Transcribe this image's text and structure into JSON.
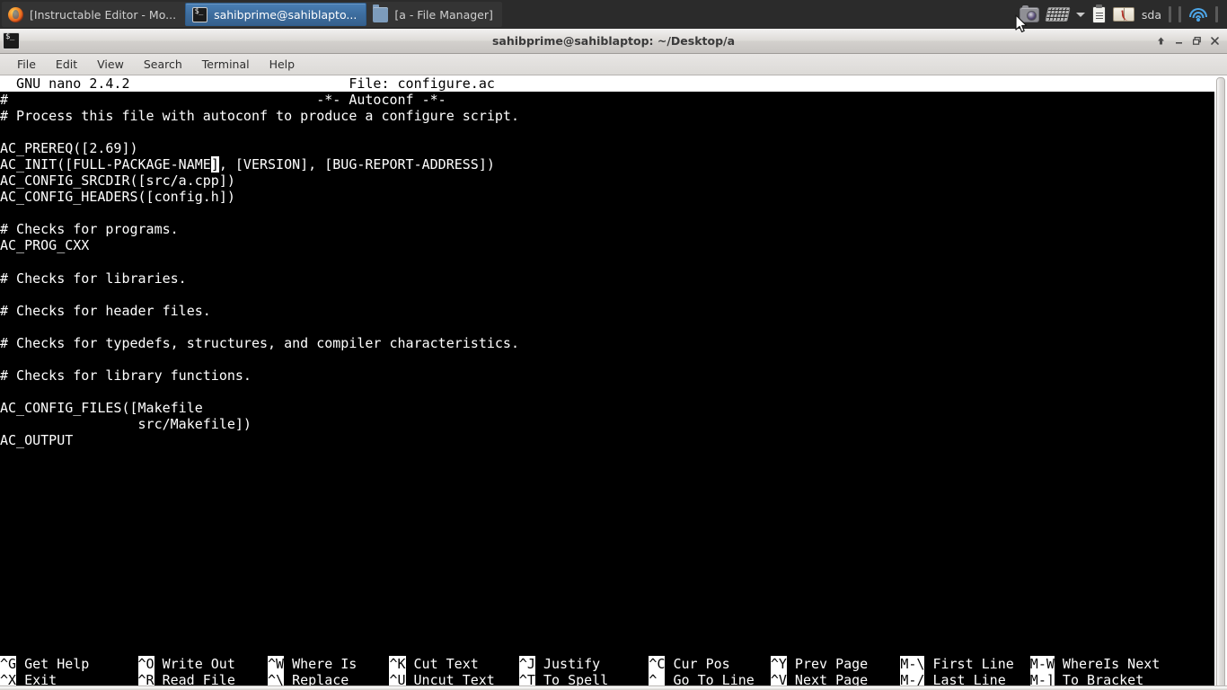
{
  "taskbar": {
    "tasks": [
      {
        "icon": "firefox-icon",
        "label": "[Instructable Editor - Mo...",
        "active": false
      },
      {
        "icon": "terminal-icon",
        "label": "sahibprime@sahiblapto...",
        "active": true
      },
      {
        "icon": "folder-icon",
        "label": "[a - File Manager]",
        "active": false
      }
    ],
    "tray": {
      "camera_icon": "camera-icon",
      "keyboard_icon": "keyboard-layout-icon",
      "caret_icon": "chevron-down-icon",
      "clipboard_icon": "clipboard-icon",
      "dictionary_icon": "dictionary-book-icon",
      "disk_label": "sda",
      "wifi_icon": "wifi-icon"
    }
  },
  "window": {
    "title": "sahibprime@sahiblaptop: ~/Desktop/a",
    "icon": "terminal-icon",
    "controls": {
      "shade": "shade-window-button",
      "minimize": "minimize-window-button",
      "maximize": "maximize-window-button",
      "close": "close-window-button"
    },
    "menus": [
      "File",
      "Edit",
      "View",
      "Search",
      "Terminal",
      "Help"
    ]
  },
  "nano": {
    "version_label": "GNU nano 2.4.2",
    "file_label": "File: configure.ac",
    "title_line": "  GNU nano 2.4.2                           File: configure.ac                                                                ",
    "lines": [
      "#                                      -*- Autoconf -*-",
      "# Process this file with autoconf to produce a configure script.",
      "",
      "AC_PREREQ([2.69])",
      "AC_CONFIG_SRCDIR([src/a.cpp])",
      "AC_CONFIG_HEADERS([config.h])",
      "",
      "# Checks for programs.",
      "AC_PROG_CXX",
      "",
      "# Checks for libraries.",
      "",
      "# Checks for header files.",
      "",
      "# Checks for typedefs, structures, and compiler characteristics.",
      "",
      "# Checks for library functions.",
      "",
      "AC_CONFIG_FILES([Makefile",
      "                 src/Makefile])",
      "AC_OUTPUT"
    ],
    "cursor_line": {
      "before": "AC_INIT([FULL-PACKAGE-NAME",
      "cursor_char": "]",
      "after": ", [VERSION], [BUG-REPORT-ADDRESS])"
    },
    "shortcuts_row1": [
      {
        "key": "^G",
        "label": " Get Help"
      },
      {
        "key": "^O",
        "label": " Write Out"
      },
      {
        "key": "^W",
        "label": " Where Is"
      },
      {
        "key": "^K",
        "label": " Cut Text"
      },
      {
        "key": "^J",
        "label": " Justify"
      },
      {
        "key": "^C",
        "label": " Cur Pos"
      },
      {
        "key": "^Y",
        "label": " Prev Page"
      },
      {
        "key": "M-\\",
        "label": " First Line"
      },
      {
        "key": "M-W",
        "label": " WhereIs Next"
      }
    ],
    "shortcuts_row2": [
      {
        "key": "^X",
        "label": " Exit"
      },
      {
        "key": "^R",
        "label": " Read File"
      },
      {
        "key": "^\\",
        "label": " Replace"
      },
      {
        "key": "^U",
        "label": " Uncut Text"
      },
      {
        "key": "^T",
        "label": " To Spell"
      },
      {
        "key": "^_",
        "label": " Go To Line"
      },
      {
        "key": "^V",
        "label": " Next Page"
      },
      {
        "key": "M-/",
        "label": " Last Line"
      },
      {
        "key": "M-]",
        "label": " To Bracket"
      }
    ]
  },
  "colors": {
    "taskbar_bg": "#2b2b2b",
    "active_task": "#3d6d9e",
    "terminal_bg": "#000000",
    "terminal_fg": "#ffffff",
    "wifi_accent": "#4da6e8"
  }
}
